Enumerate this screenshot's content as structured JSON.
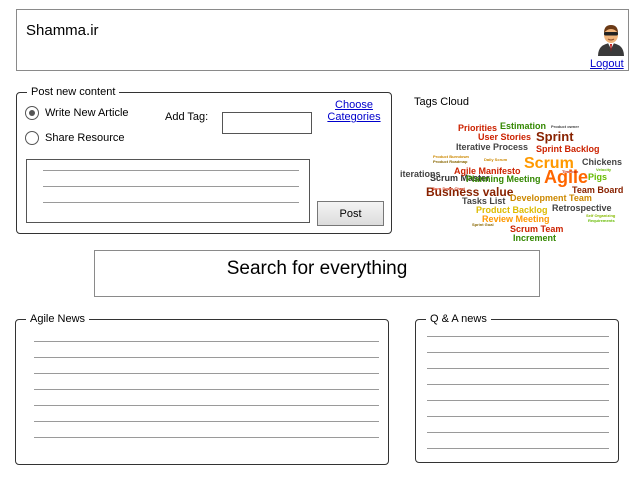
{
  "header": {
    "site_name": "Shamma.ir",
    "logout_label": "Logout"
  },
  "post": {
    "legend": "Post new content",
    "option_article": "Write New Article",
    "option_resource": "Share Resource",
    "selected": "article",
    "add_tag_label": "Add Tag:",
    "tag_value": "",
    "choose_label": "Choose",
    "categories_label": "Categories",
    "post_button": "Post"
  },
  "tags": {
    "title": "Tags Cloud",
    "words": [
      {
        "text": "Priorities",
        "color": "#cc2200"
      },
      {
        "text": "Estimation",
        "color": "#338800"
      },
      {
        "text": "Product owner",
        "color": "#444444"
      },
      {
        "text": "User Stories",
        "color": "#cc2200"
      },
      {
        "text": "Sprint",
        "color": "#882200"
      },
      {
        "text": "Iterative Process",
        "color": "#444444"
      },
      {
        "text": "Sprint Backlog",
        "color": "#cc2200"
      },
      {
        "text": "Product Burndown",
        "color": "#cc8800"
      },
      {
        "text": "Product Roadmap",
        "color": "#886600"
      },
      {
        "text": "Scrum Master",
        "color": "#333333"
      },
      {
        "text": "Scrum",
        "color": "#ff9900"
      },
      {
        "text": "Chickens",
        "color": "#444444"
      },
      {
        "text": "Agile Manifesto",
        "color": "#cc2200"
      },
      {
        "text": "Agile",
        "color": "#ff6600"
      },
      {
        "text": "iterations",
        "color": "#444444"
      },
      {
        "text": "Planning Meeting",
        "color": "#338800"
      },
      {
        "text": "Pigs",
        "color": "#66bb00"
      },
      {
        "text": "Business value",
        "color": "#882200"
      },
      {
        "text": "Team Board",
        "color": "#882200"
      },
      {
        "text": "Tasks List",
        "color": "#444444"
      },
      {
        "text": "Development Team",
        "color": "#cc8800"
      },
      {
        "text": "Product Backlog",
        "color": "#ddbb00"
      },
      {
        "text": "Retrospective",
        "color": "#444444"
      },
      {
        "text": "Review Meeting",
        "color": "#ff9900"
      },
      {
        "text": "Scrum Team",
        "color": "#cc2200"
      },
      {
        "text": "Increment",
        "color": "#338800"
      },
      {
        "text": "Daily Scrum",
        "color": "#cc8800"
      },
      {
        "text": "Velocity",
        "color": "#66bb00"
      },
      {
        "text": "Timebox",
        "color": "#cc2200"
      },
      {
        "text": "Self Organizing",
        "color": "#88bb00"
      },
      {
        "text": "Sprint Goal",
        "color": "#886600"
      },
      {
        "text": "Requirements",
        "color": "#66bb00"
      },
      {
        "text": "Burn Down Chart",
        "color": "#cc2200"
      }
    ]
  },
  "search": {
    "text": "Search for everything"
  },
  "agile_news": {
    "title": "Agile News"
  },
  "qa_news": {
    "title": "Q & A news"
  }
}
